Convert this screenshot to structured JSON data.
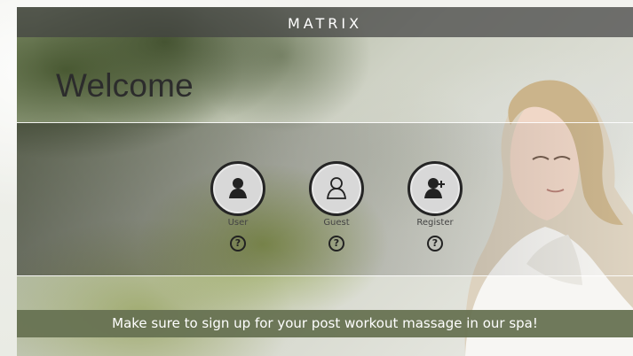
{
  "header": {
    "brand": "MATRIX"
  },
  "main": {
    "title": "Welcome",
    "profiles": [
      {
        "label": "User",
        "icon": "user-icon",
        "help_glyph": "?"
      },
      {
        "label": "Guest",
        "icon": "guest-icon",
        "help_glyph": "?"
      },
      {
        "label": "Register",
        "icon": "register-icon",
        "help_glyph": "?"
      }
    ]
  },
  "footer": {
    "message": "Make sure to sign up for your post workout massage in our spa!"
  },
  "colors": {
    "header_bar": "#424242",
    "banner": "#677252",
    "button_dark": "#252525",
    "button_light": "#d8d8d8"
  }
}
